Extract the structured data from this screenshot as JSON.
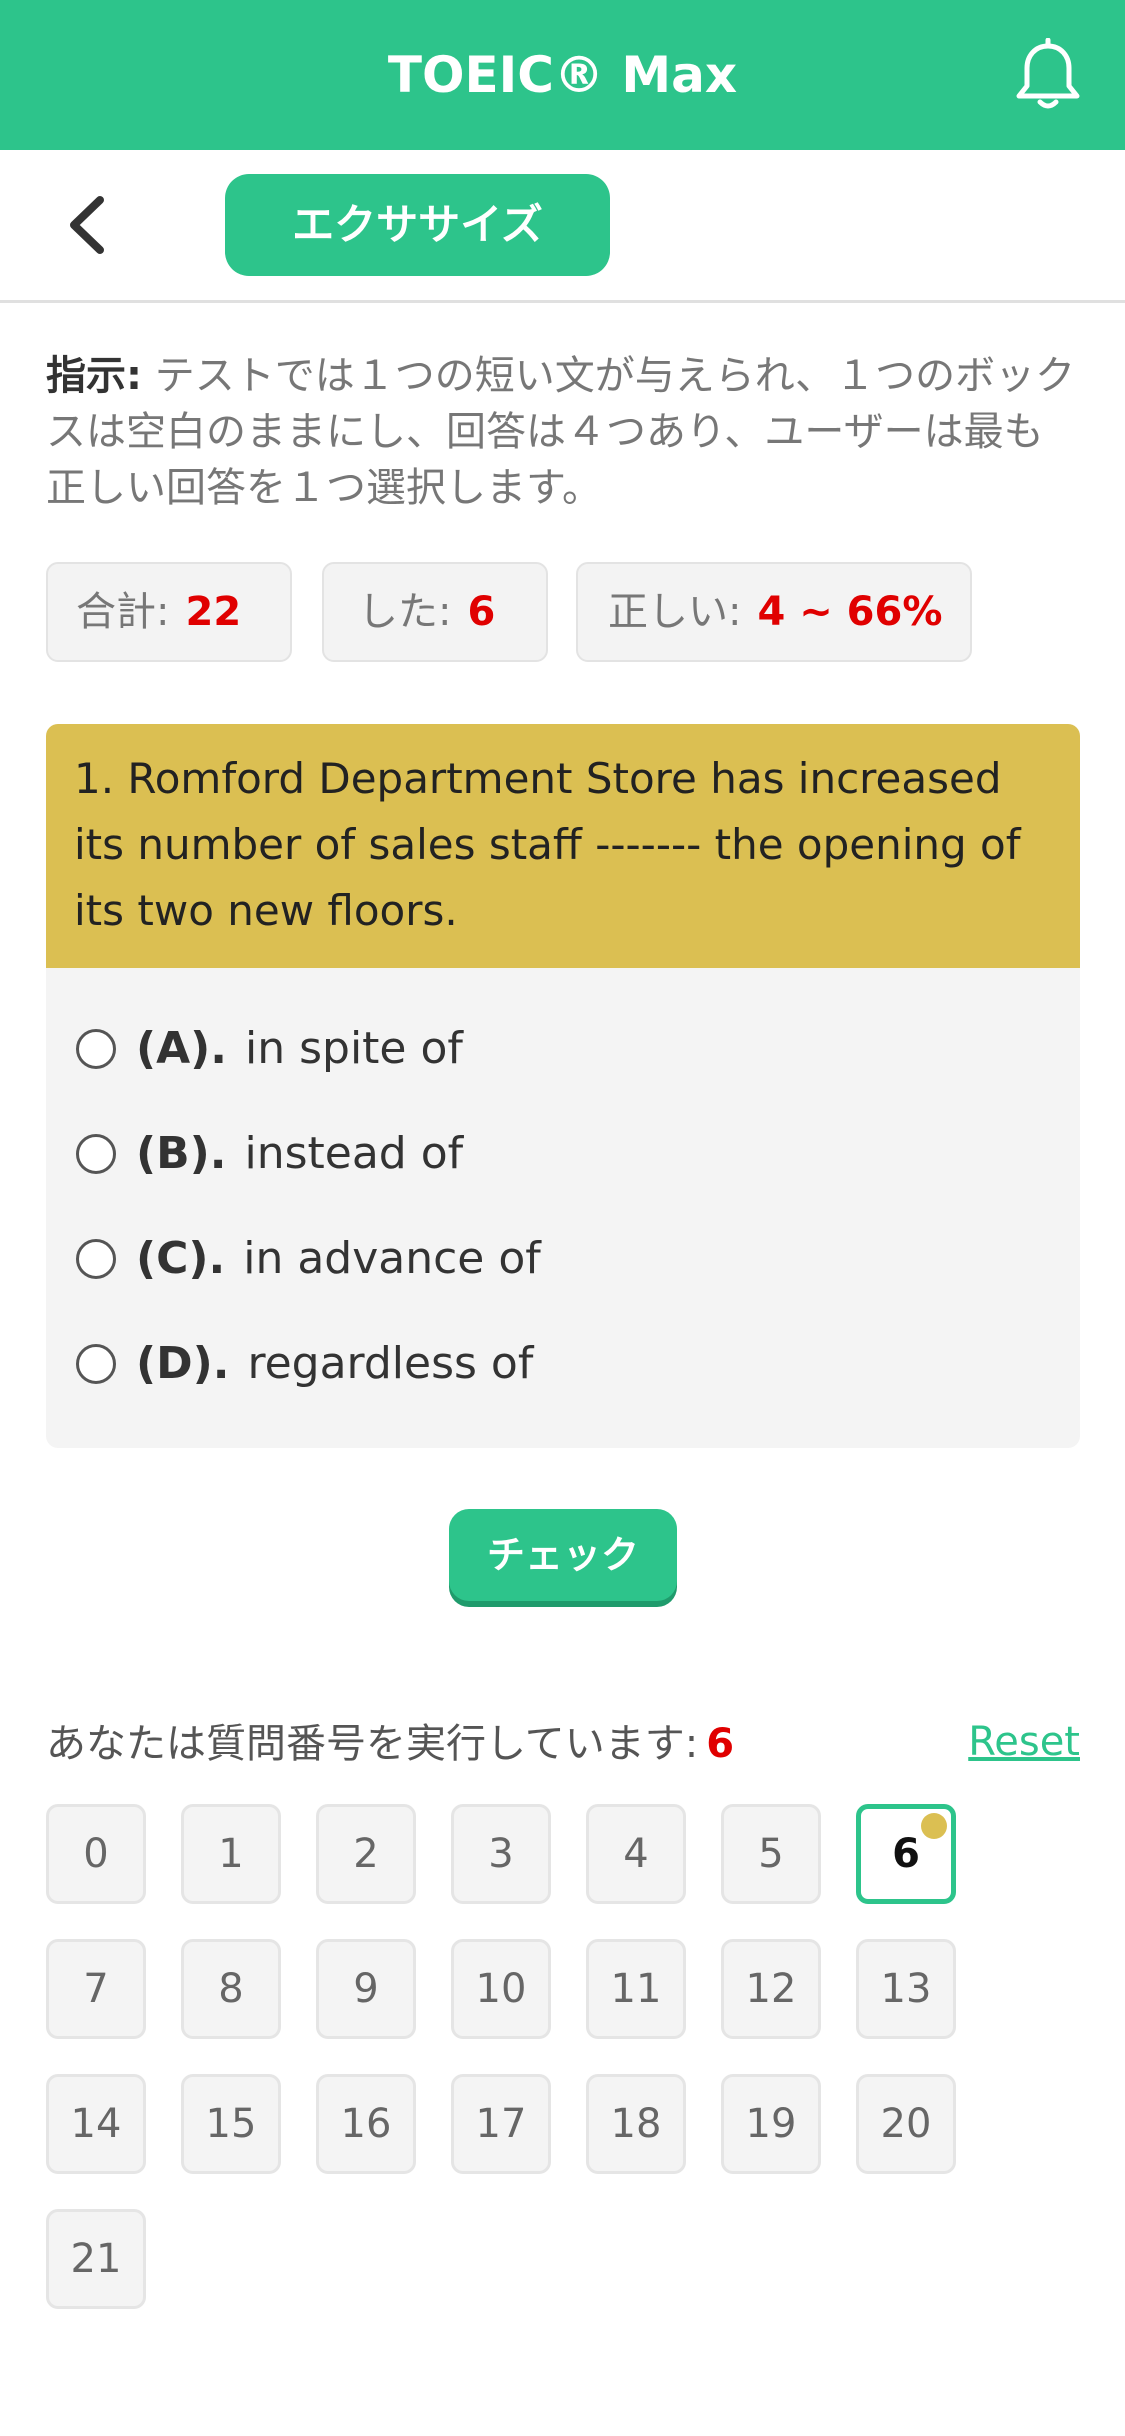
{
  "header": {
    "title": "TOEIC® Max",
    "bell_icon": "bell-icon"
  },
  "subbar": {
    "back_icon": "chevron-left-icon",
    "tab_label": "エクササイズ"
  },
  "instructions": {
    "label": "指示:",
    "text": " テストでは１つの短い文が与えられ、１つのボックスは空白のままにし、回答は４つあり、ユーザーは最も正しい回答を１つ選択します。"
  },
  "stats": {
    "total_label": "合計:",
    "total_value": "22",
    "done_label": "した:",
    "done_value": "6",
    "correct_label": "正しい:",
    "correct_value": "4 ~ 66%"
  },
  "question": {
    "text": "1. Romford Department Store has increased its number of sales staff ------- the opening of its two new floors.",
    "options": [
      {
        "letter": "(A).",
        "text": "in spite of"
      },
      {
        "letter": "(B).",
        "text": "instead of"
      },
      {
        "letter": "(C).",
        "text": "in advance of"
      },
      {
        "letter": "(D).",
        "text": "regardless of"
      }
    ]
  },
  "check_label": "チェック",
  "navigator": {
    "running_label": "あなたは質問番号を実行しています:",
    "current": "6",
    "reset_label": "Reset",
    "numbers": [
      "0",
      "1",
      "2",
      "3",
      "4",
      "5",
      "6",
      "7",
      "8",
      "9",
      "10",
      "11",
      "12",
      "13",
      "14",
      "15",
      "16",
      "17",
      "18",
      "19",
      "20",
      "21"
    ]
  },
  "colors": {
    "brand": "#2dc48b",
    "question_header": "#dbbf52",
    "highlight": "#e00000"
  }
}
